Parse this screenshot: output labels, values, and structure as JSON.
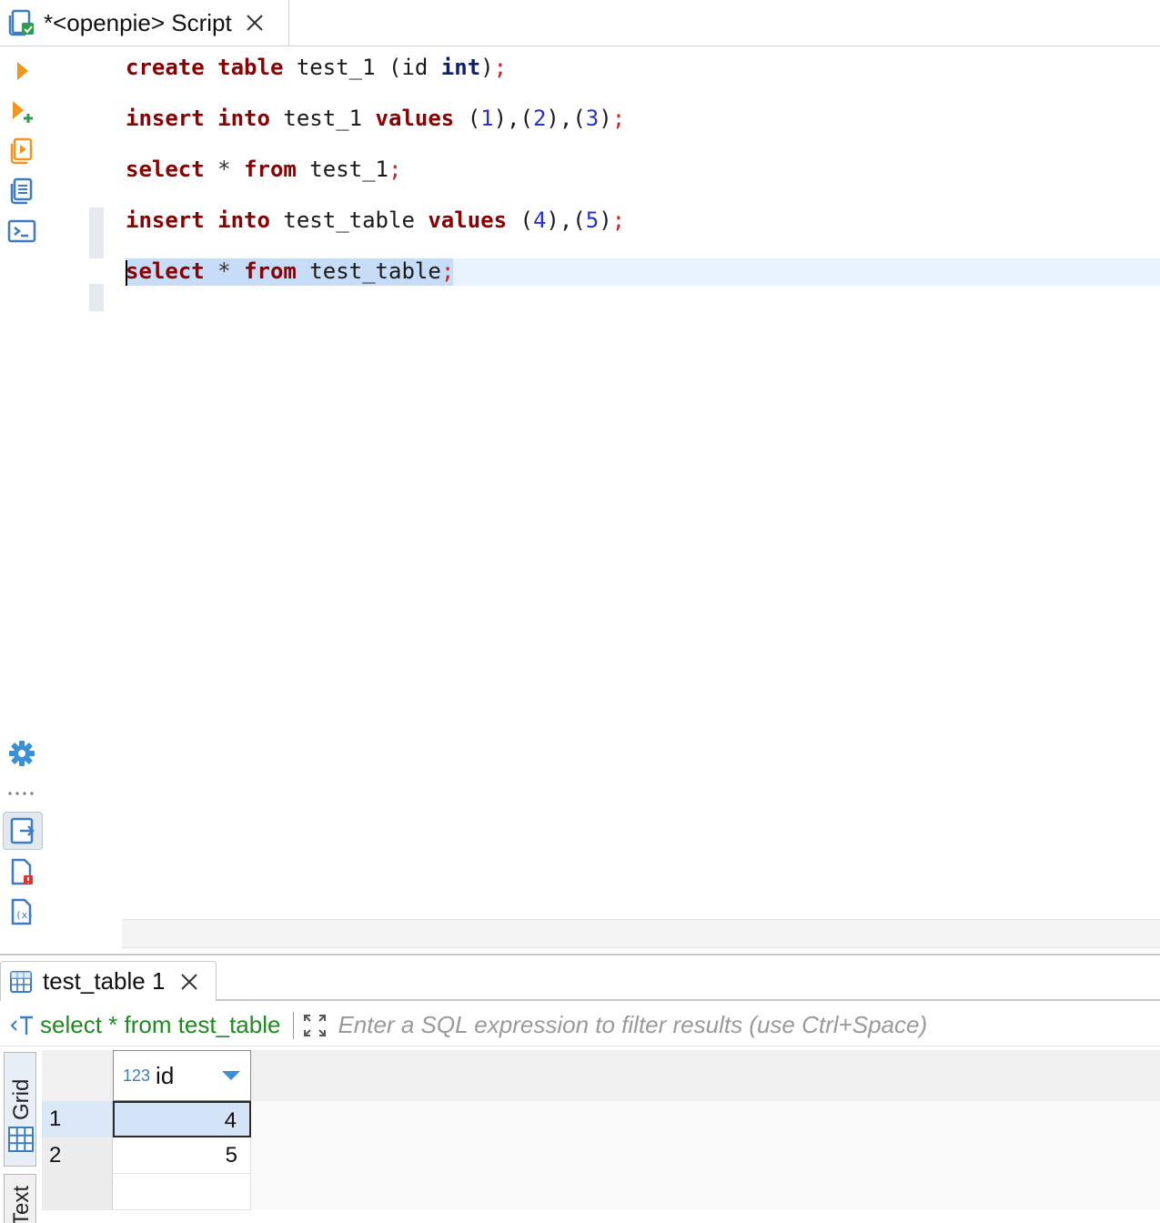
{
  "editor_tab": {
    "title": "*<openpie> Script",
    "icon": "sql-script-icon",
    "close_icon": "close-icon"
  },
  "left_toolbar": {
    "top_items": [
      {
        "icon": "execute-statement-icon"
      },
      {
        "icon": "execute-in-new-tab-icon"
      },
      {
        "icon": "execute-script-icon"
      },
      {
        "icon": "explain-plan-icon"
      },
      {
        "icon": "open-console-icon"
      }
    ],
    "bottom_items": [
      {
        "icon": "settings-gear-icon"
      },
      {
        "icon": "more-dots-icon"
      },
      {
        "icon": "show-results-panel-icon"
      },
      {
        "icon": "show-output-log-icon"
      },
      {
        "icon": "show-variables-icon"
      }
    ]
  },
  "editor": {
    "lines": [
      [
        {
          "t": "create",
          "c": "kw"
        },
        {
          "t": " ",
          "c": "id"
        },
        {
          "t": "table",
          "c": "kw"
        },
        {
          "t": " test_1 (id ",
          "c": "id"
        },
        {
          "t": "int",
          "c": "tp"
        },
        {
          "t": ")",
          "c": "id"
        },
        {
          "t": ";",
          "c": "semi"
        }
      ],
      [
        {
          "t": "insert",
          "c": "kw"
        },
        {
          "t": " ",
          "c": "id"
        },
        {
          "t": "into",
          "c": "kw"
        },
        {
          "t": " test_1 ",
          "c": "id"
        },
        {
          "t": "values",
          "c": "kw"
        },
        {
          "t": " (",
          "c": "id"
        },
        {
          "t": "1",
          "c": "num"
        },
        {
          "t": "),(",
          "c": "id"
        },
        {
          "t": "2",
          "c": "num"
        },
        {
          "t": "),(",
          "c": "id"
        },
        {
          "t": "3",
          "c": "num"
        },
        {
          "t": ")",
          "c": "id"
        },
        {
          "t": ";",
          "c": "semi"
        }
      ],
      [
        {
          "t": "select",
          "c": "kw"
        },
        {
          "t": " ",
          "c": "id"
        },
        {
          "t": "*",
          "c": "op"
        },
        {
          "t": " ",
          "c": "id"
        },
        {
          "t": "from",
          "c": "kw"
        },
        {
          "t": " test_1",
          "c": "id"
        },
        {
          "t": ";",
          "c": "semi"
        }
      ],
      [
        {
          "t": "insert",
          "c": "kw"
        },
        {
          "t": " ",
          "c": "id"
        },
        {
          "t": "into",
          "c": "kw"
        },
        {
          "t": " test_table ",
          "c": "id"
        },
        {
          "t": "values",
          "c": "kw"
        },
        {
          "t": " (",
          "c": "id"
        },
        {
          "t": "4",
          "c": "num"
        },
        {
          "t": "),(",
          "c": "id"
        },
        {
          "t": "5",
          "c": "num"
        },
        {
          "t": ")",
          "c": "id"
        },
        {
          "t": ";",
          "c": "semi"
        }
      ],
      [
        {
          "t": "select",
          "c": "kw"
        },
        {
          "t": " ",
          "c": "id"
        },
        {
          "t": "*",
          "c": "op"
        },
        {
          "t": " ",
          "c": "id"
        },
        {
          "t": "from",
          "c": "kw"
        },
        {
          "t": " test_table",
          "c": "id"
        },
        {
          "t": ";",
          "c": "semi"
        }
      ]
    ]
  },
  "results": {
    "tab_label": "test_table 1",
    "query_text": "select * from test_table",
    "filter_placeholder": "Enter a SQL expression to filter results (use Ctrl+Space)",
    "side_tabs": [
      "Grid",
      "Text"
    ],
    "grid": {
      "column": {
        "type_badge": "123",
        "name": "id"
      },
      "rows": [
        {
          "num": "1",
          "id": "4"
        },
        {
          "num": "2",
          "id": "5"
        }
      ]
    }
  },
  "colors": {
    "keyword": "#8b0000",
    "type": "#0a1f7a",
    "number": "#2233cc",
    "semicolon": "#cc2222",
    "query_text": "#1f8a1f",
    "selection": "#c6dcf7",
    "current_line": "#e9f2ff",
    "accent": "#3b7cc4"
  }
}
